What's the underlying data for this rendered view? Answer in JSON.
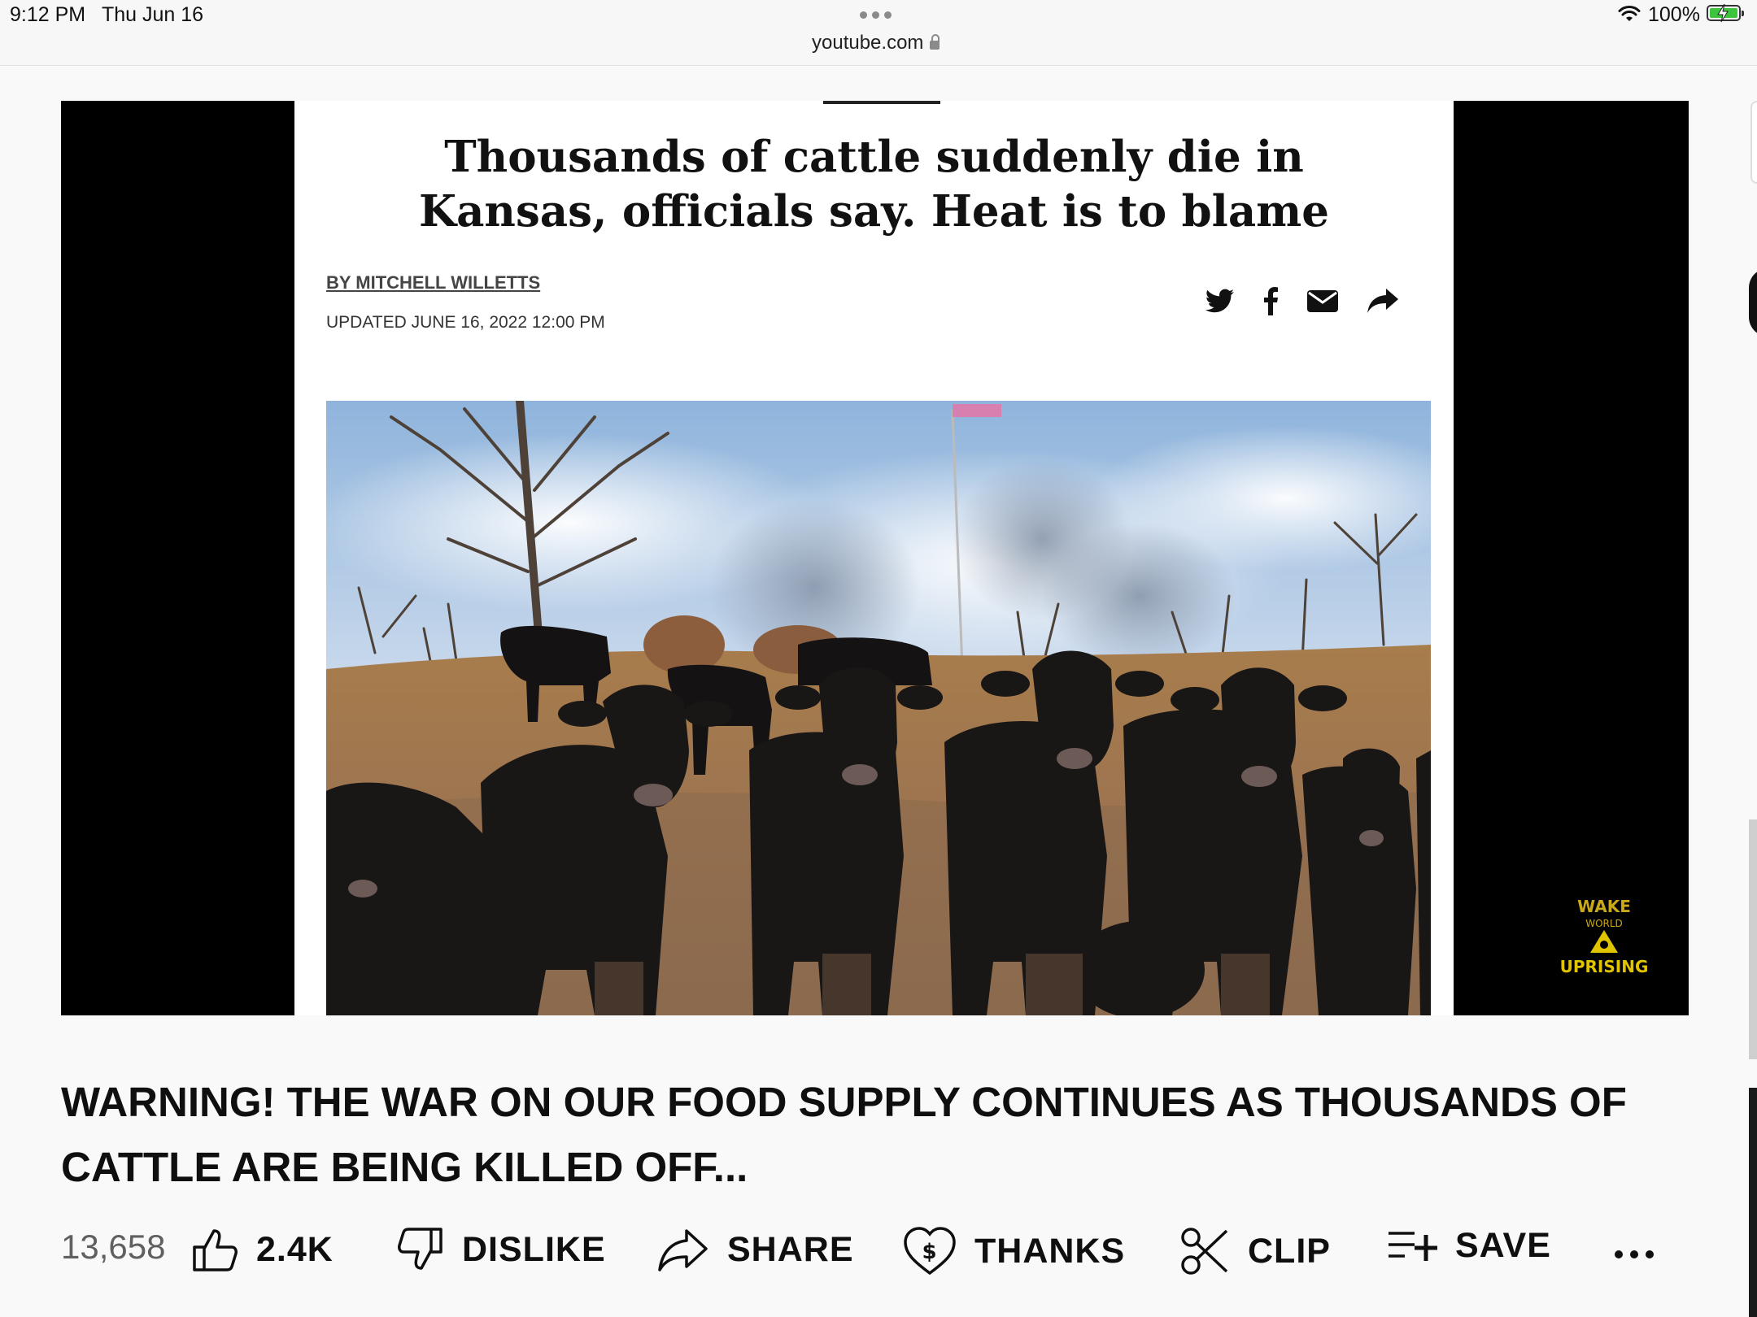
{
  "status_bar": {
    "time": "9:12 PM",
    "date": "Thu Jun 16",
    "battery_pct": "100%",
    "battery_level": 1.0,
    "battery_color": "#3cc43c"
  },
  "browser": {
    "url": "youtube.com"
  },
  "video_frame": {
    "headline": "Thousands of cattle suddenly die in Kansas, officials say. Heat is to blame",
    "byline": "BY MITCHELL WILLETTS",
    "updated": "UPDATED JUNE 16, 2022 12:00 PM",
    "share_icons": [
      "twitter-icon",
      "facebook-icon",
      "email-icon",
      "share-arrow-icon"
    ],
    "photo": "herd-of-black-cattle-photo",
    "watermark": "channel-watermark-logo"
  },
  "video": {
    "title": "WARNING! THE WAR ON OUR FOOD SUPPLY CONTINUES AS THOUSANDS OF CATTLE ARE BEING KILLED OFF...",
    "views": "13,658"
  },
  "actions": {
    "like_count": "2.4K",
    "dislike_label": "DISLIKE",
    "share_label": "SHARE",
    "thanks_label": "THANKS",
    "clip_label": "CLIP",
    "save_label": "SAVE"
  }
}
